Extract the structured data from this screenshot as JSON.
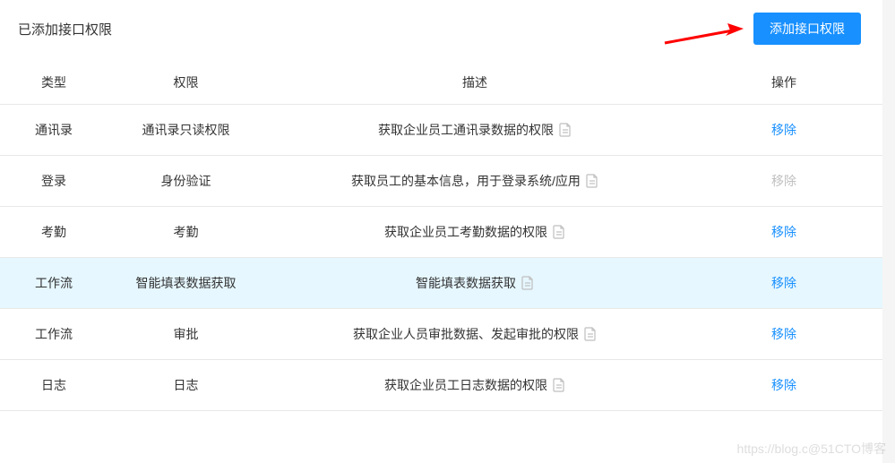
{
  "section_title": "已添加接口权限",
  "add_button_label": "添加接口权限",
  "columns": {
    "type": "类型",
    "permission": "权限",
    "description": "描述",
    "operation": "操作"
  },
  "rows": [
    {
      "type": "通讯录",
      "permission": "通讯录只读权限",
      "description": "获取企业员工通讯录数据的权限",
      "action": "移除",
      "disabled": false,
      "selected": false
    },
    {
      "type": "登录",
      "permission": "身份验证",
      "description": "获取员工的基本信息，用于登录系统/应用",
      "action": "移除",
      "disabled": true,
      "selected": false
    },
    {
      "type": "考勤",
      "permission": "考勤",
      "description": "获取企业员工考勤数据的权限",
      "action": "移除",
      "disabled": false,
      "selected": false
    },
    {
      "type": "工作流",
      "permission": "智能填表数据获取",
      "description": "智能填表数据获取",
      "action": "移除",
      "disabled": false,
      "selected": true
    },
    {
      "type": "工作流",
      "permission": "审批",
      "description": "获取企业人员审批数据、发起审批的权限",
      "action": "移除",
      "disabled": false,
      "selected": false
    },
    {
      "type": "日志",
      "permission": "日志",
      "description": "获取企业员工日志数据的权限",
      "action": "移除",
      "disabled": false,
      "selected": false
    }
  ],
  "watermark": "https://blog.c@51CTO博客"
}
